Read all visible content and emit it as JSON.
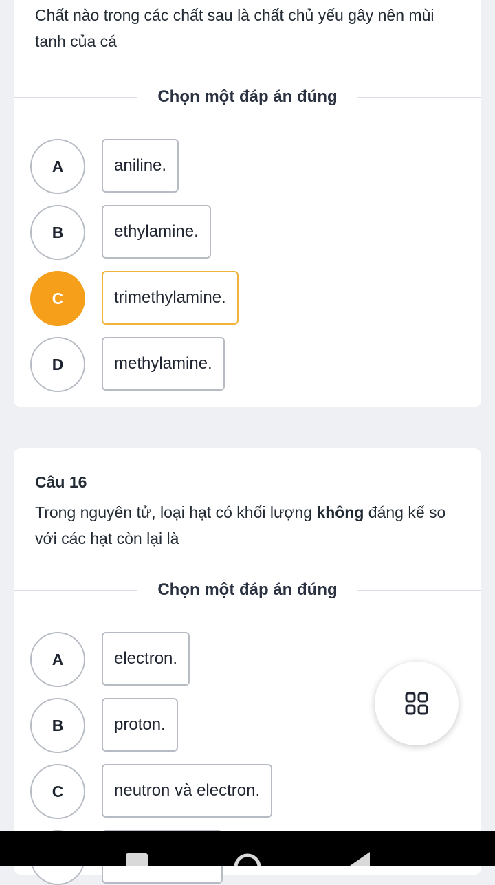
{
  "q1": {
    "text": "Chất nào trong các chất sau là chất chủ yếu gây nên mùi tanh của cá",
    "divider_label": "Chọn một đáp án đúng",
    "options": [
      {
        "letter": "A",
        "text": "aniline."
      },
      {
        "letter": "B",
        "text": "ethylamine."
      },
      {
        "letter": "C",
        "text": "trimethylamine."
      },
      {
        "letter": "D",
        "text": "methylamine."
      }
    ],
    "selected": "C"
  },
  "q2": {
    "number": "Câu 16",
    "text_before": "Trong nguyên tử, loại hạt có khối lượng ",
    "text_bold": "không",
    "text_after": " đáng kể so với các hạt còn lại là",
    "divider_label": "Chọn một đáp án đúng",
    "options": [
      {
        "letter": "A",
        "text": "electron."
      },
      {
        "letter": "B",
        "text": "proton."
      },
      {
        "letter": "C",
        "text": "neutron và electron."
      }
    ]
  },
  "fab": {
    "icon": "grid-icon"
  },
  "navbar": {
    "icons": [
      "recents-icon",
      "home-icon",
      "back-icon"
    ]
  },
  "colors": {
    "accent": "#f59f1b",
    "background": "#eef0f3",
    "border": "#b7bcc4"
  }
}
